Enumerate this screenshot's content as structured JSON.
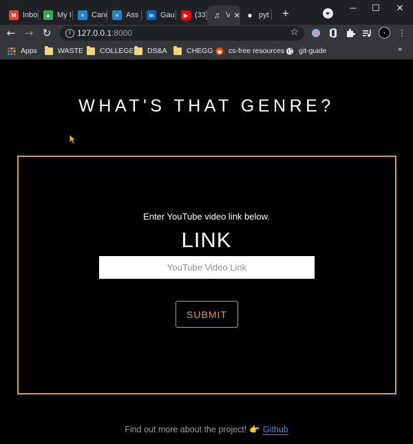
{
  "browser": {
    "tabs": [
      {
        "label": "Inbo",
        "icon": "gmail-icon",
        "color": "#ea4335",
        "glyph": "M",
        "active": false
      },
      {
        "label": "My I",
        "icon": "google-drive-icon",
        "color": "#34a853",
        "glyph": "▲",
        "active": false
      },
      {
        "label": "Canc",
        "icon": "cancel-app-icon",
        "color": "#1e88c9",
        "glyph": "≡",
        "active": false
      },
      {
        "label": "Ass",
        "icon": "assessment-app-icon",
        "color": "#1e88c9",
        "glyph": "≡",
        "active": false
      },
      {
        "label": "Gau",
        "icon": "linkedin-icon",
        "color": "#0a66c2",
        "glyph": "in",
        "active": false
      },
      {
        "label": "(33)",
        "icon": "youtube-icon",
        "color": "#ff0000",
        "glyph": "▶",
        "active": false
      },
      {
        "label": "V",
        "icon": "music-note-icon",
        "color": "#f1f3f4",
        "glyph": "♫",
        "active": true
      },
      {
        "label": "pyt",
        "icon": "github-icon",
        "color": "#f1f3f4",
        "glyph": "●",
        "active": false
      }
    ],
    "new_tab_glyph": "+",
    "window_controls": {
      "minimize": "─",
      "maximize": "☐",
      "close": "✕"
    },
    "address": {
      "host": "127.0.0.1",
      "port": ":8000"
    },
    "bookmarks": [
      {
        "label": "Apps",
        "icon": "apps-grid-icon"
      },
      {
        "label": "WASTE",
        "icon": "folder-icon"
      },
      {
        "label": "COLLEGE",
        "icon": "folder-icon"
      },
      {
        "label": "DS&A",
        "icon": "folder-icon"
      },
      {
        "label": "CHEGG",
        "icon": "folder-icon"
      },
      {
        "label": "cs-free resources",
        "icon": "reddit-icon"
      },
      {
        "label": "git-guide",
        "icon": "globe-icon"
      }
    ],
    "bookmarks_more": "»"
  },
  "page": {
    "title": "WHAT'S THAT GENRE?",
    "hint": "Enter YouTube video link below.",
    "heading": "LINK",
    "input_placeholder": "YouTube Video Link",
    "submit_label": "SUBMIT",
    "footer_text": "Find out more about the project!",
    "footer_emoji": "👉",
    "footer_link": "Github",
    "accent_color": "#d6a336"
  }
}
